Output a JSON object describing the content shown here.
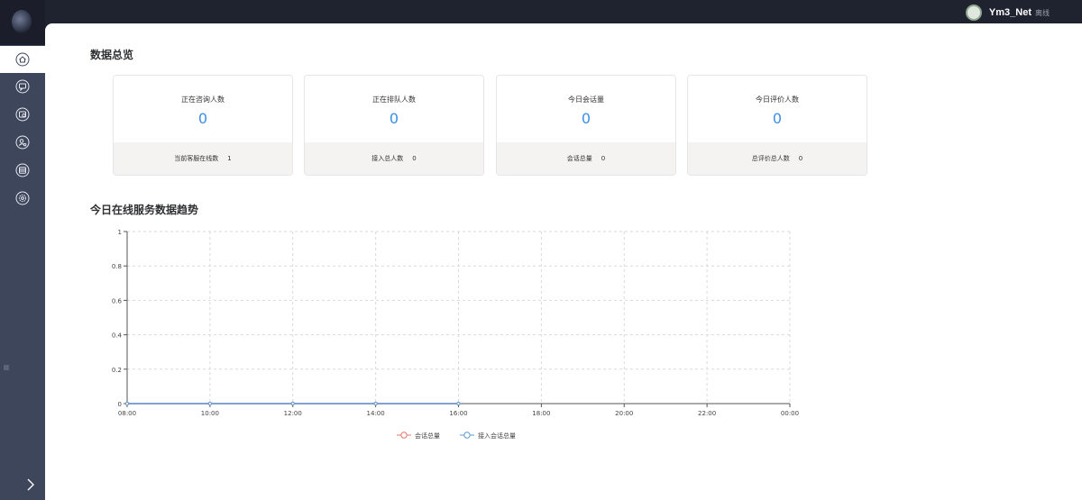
{
  "header": {
    "username": "Ym3_Net",
    "status": "离线"
  },
  "sidebar": {
    "items": [
      {
        "icon": "home-icon",
        "active": true
      },
      {
        "icon": "chat-bubble-icon",
        "active": false
      },
      {
        "icon": "history-icon",
        "active": false
      },
      {
        "icon": "user-settings-icon",
        "active": false
      },
      {
        "icon": "list-icon",
        "active": false
      },
      {
        "icon": "gear-icon",
        "active": false
      }
    ]
  },
  "overview": {
    "title": "数据总览",
    "cards": [
      {
        "label": "正在咨询人数",
        "value": "0",
        "foot_label": "当前客服在线数",
        "foot_value": "1"
      },
      {
        "label": "正在排队人数",
        "value": "0",
        "foot_label": "接入总人数",
        "foot_value": "0"
      },
      {
        "label": "今日会话量",
        "value": "0",
        "foot_label": "会话总量",
        "foot_value": "0"
      },
      {
        "label": "今日评价人数",
        "value": "0",
        "foot_label": "总评价总人数",
        "foot_value": "0"
      }
    ]
  },
  "trend": {
    "title": "今日在线服务数据趋势"
  },
  "chart_data": {
    "type": "line",
    "title": "",
    "xlabel": "",
    "ylabel": "",
    "x": [
      "08:00",
      "10:00",
      "12:00",
      "14:00",
      "16:00",
      "18:00",
      "20:00",
      "22:00",
      "00:00"
    ],
    "ylim": [
      0,
      1
    ],
    "yticks": [
      "0",
      "0.2",
      "0.4",
      "0.6",
      "0.8",
      "1"
    ],
    "grid": true,
    "legend": "bottom",
    "series": [
      {
        "name": "会话总量",
        "color": "#e8746a",
        "values": [
          0,
          0,
          0,
          0,
          0
        ]
      },
      {
        "name": "接入会话总量",
        "color": "#5b9bd5",
        "values": [
          0,
          0,
          0,
          0,
          0
        ]
      }
    ]
  }
}
